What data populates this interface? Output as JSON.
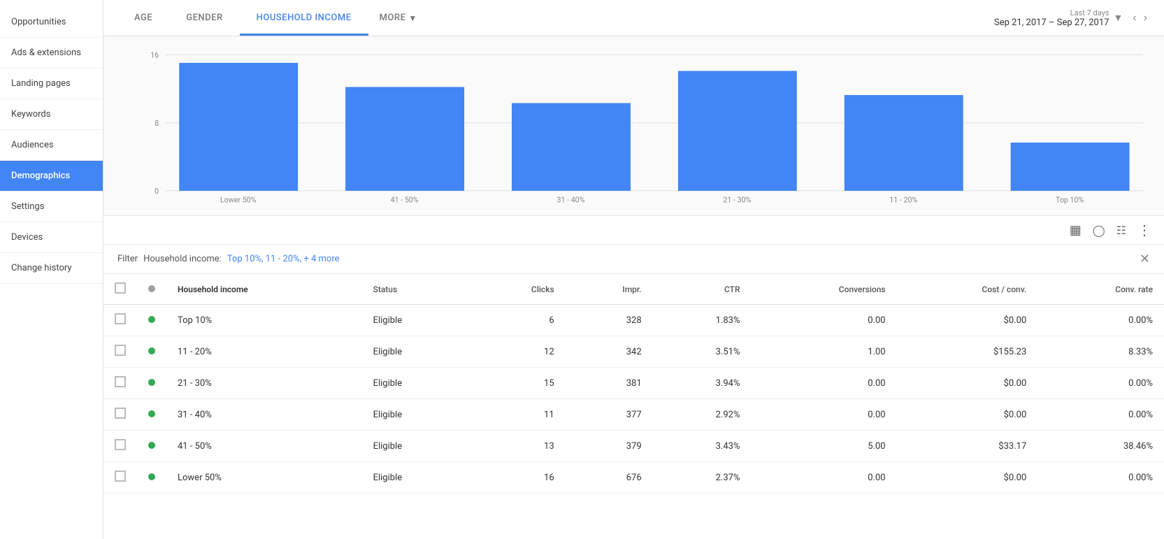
{
  "sidebar": {
    "items": [
      {
        "id": "opportunities",
        "label": "Opportunities",
        "active": false
      },
      {
        "id": "ads-extensions",
        "label": "Ads & extensions",
        "active": false
      },
      {
        "id": "landing-pages",
        "label": "Landing pages",
        "active": false
      },
      {
        "id": "keywords",
        "label": "Keywords",
        "active": false
      },
      {
        "id": "audiences",
        "label": "Audiences",
        "active": false
      },
      {
        "id": "demographics",
        "label": "Demographics",
        "active": true
      },
      {
        "id": "settings",
        "label": "Settings",
        "active": false
      },
      {
        "id": "devices",
        "label": "Devices",
        "active": false
      },
      {
        "id": "change-history",
        "label": "Change history",
        "active": false
      }
    ]
  },
  "tabs": [
    {
      "id": "age",
      "label": "AGE",
      "active": false
    },
    {
      "id": "gender",
      "label": "GENDER",
      "active": false
    },
    {
      "id": "household-income",
      "label": "HOUSEHOLD INCOME",
      "active": true
    },
    {
      "id": "more",
      "label": "MORE",
      "active": false,
      "hasDropdown": true
    }
  ],
  "dateRange": {
    "label": "Last 7 days",
    "dates": "Sep 21, 2017 – Sep 27, 2017"
  },
  "chart": {
    "yAxisLabels": [
      "0",
      "8",
      "16"
    ],
    "bars": [
      {
        "label": "Lower 50%",
        "value": 16,
        "color": "#4285f4"
      },
      {
        "label": "41 - 50%",
        "value": 13,
        "color": "#4285f4"
      },
      {
        "label": "31 - 40%",
        "value": 11,
        "color": "#4285f4"
      },
      {
        "label": "21 - 30%",
        "value": 15,
        "color": "#4285f4"
      },
      {
        "label": "11 - 20%",
        "value": 12,
        "color": "#4285f4"
      },
      {
        "label": "Top 10%",
        "value": 6,
        "color": "#4285f4"
      }
    ],
    "maxValue": 17
  },
  "filter": {
    "label": "Household income:",
    "value": "Top 10%, 11 - 20%, + 4 more"
  },
  "table": {
    "columns": [
      {
        "id": "checkbox",
        "label": ""
      },
      {
        "id": "status",
        "label": ""
      },
      {
        "id": "name",
        "label": "Household income"
      },
      {
        "id": "status-text",
        "label": "Status"
      },
      {
        "id": "clicks",
        "label": "Clicks"
      },
      {
        "id": "impr",
        "label": "Impr."
      },
      {
        "id": "ctr",
        "label": "CTR"
      },
      {
        "id": "conversions",
        "label": "Conversions"
      },
      {
        "id": "cost-conv",
        "label": "Cost / conv."
      },
      {
        "id": "conv-rate",
        "label": "Conv. rate"
      }
    ],
    "rows": [
      {
        "name": "Top 10%",
        "status": "Eligible",
        "clicks": "6",
        "impr": "328",
        "ctr": "1.83%",
        "conversions": "0.00",
        "costConv": "$0.00",
        "convRate": "0.00%"
      },
      {
        "name": "11 - 20%",
        "status": "Eligible",
        "clicks": "12",
        "impr": "342",
        "ctr": "3.51%",
        "conversions": "1.00",
        "costConv": "$155.23",
        "convRate": "8.33%"
      },
      {
        "name": "21 - 30%",
        "status": "Eligible",
        "clicks": "15",
        "impr": "381",
        "ctr": "3.94%",
        "conversions": "0.00",
        "costConv": "$0.00",
        "convRate": "0.00%"
      },
      {
        "name": "31 - 40%",
        "status": "Eligible",
        "clicks": "11",
        "impr": "377",
        "ctr": "2.92%",
        "conversions": "0.00",
        "costConv": "$0.00",
        "convRate": "0.00%"
      },
      {
        "name": "41 - 50%",
        "status": "Eligible",
        "clicks": "13",
        "impr": "379",
        "ctr": "3.43%",
        "conversions": "5.00",
        "costConv": "$33.17",
        "convRate": "38.46%"
      },
      {
        "name": "Lower 50%",
        "status": "Eligible",
        "clicks": "16",
        "impr": "676",
        "ctr": "2.37%",
        "conversions": "0.00",
        "costConv": "$0.00",
        "convRate": "0.00%"
      }
    ]
  }
}
